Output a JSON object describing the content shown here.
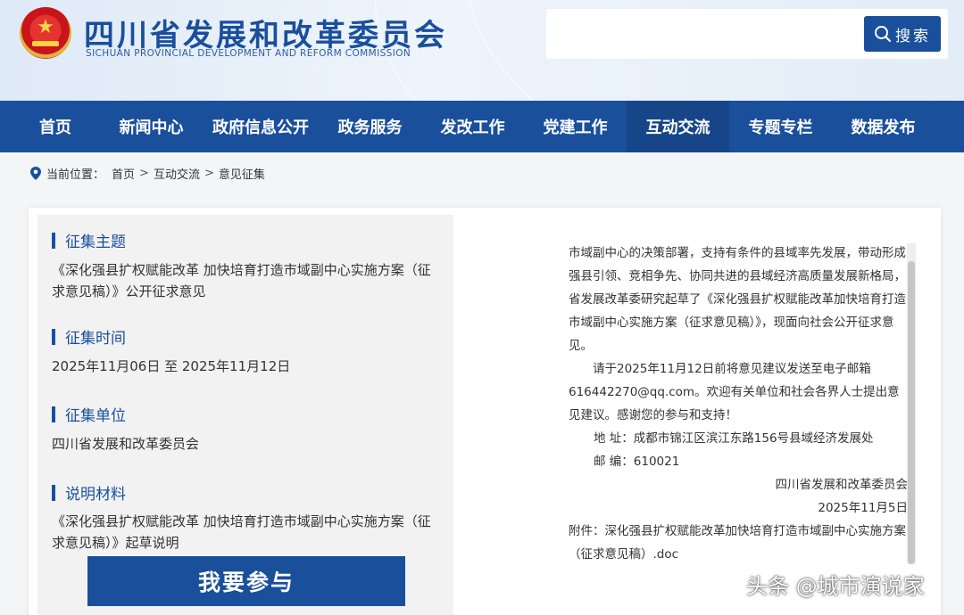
{
  "header": {
    "title": "四川省发展和改革委员会",
    "subtitle": "SICHUAN PROVINCIAL DEVELOPMENT AND REFORM COMMISSION",
    "search_value": "",
    "search_button": "搜索",
    "brand_color": "#1a4f9c"
  },
  "nav": {
    "items": [
      "首页",
      "新闻中心",
      "政府信息公开",
      "政务服务",
      "发改工作",
      "党建工作",
      "互动交流",
      "专题专栏",
      "数据发布"
    ],
    "active": "互动交流"
  },
  "breadcrumb": {
    "prefix": "当前位置：",
    "items": [
      "首页",
      "互动交流",
      "意见征集"
    ],
    "separator": ">"
  },
  "consultation": {
    "topic_label": "征集主题",
    "topic": "《深化强县扩权赋能改革 加快培育打造市域副中心实施方案（征求意见稿）》公开征求意见",
    "time_label": "征集时间",
    "time": "2025年11月06日 至 2025年11月12日",
    "unit_label": "征集单位",
    "unit": "四川省发展和改革委员会",
    "material_label": "说明材料",
    "material": "《深化强县扩权赋能改革 加快培育打造市域副中心实施方案（征求意见稿）》起草说明",
    "join_button": "我要参与"
  },
  "notice": {
    "para1": "市域副中心的决策部署，支持有条件的县域率先发展，带动形成强县引领、竞相争先、协同共进的县域经济高质量发展新格局，省发展改革委研究起草了《深化强县扩权赋能改革加快培育打造市域副中心实施方案（征求意见稿）》，现面向社会公开征求意见。",
    "para2": "请于2025年11月12日前将意见建议发送至电子邮箱616442270@qq.com。欢迎有关单位和社会各界人士提出意见建议。感谢您的参与和支持！",
    "address": "地 址：成都市锦江区滨江东路156号县域经济发展处",
    "postcode": "邮 编：610021",
    "signer": "四川省发展和改革委员会",
    "date": "2025年11月5日",
    "attachment": "附件：深化强县扩权赋能改革加快培育打造市域副中心实施方案（征求意见稿）.doc"
  },
  "watermark": "头条 @城市演说家"
}
